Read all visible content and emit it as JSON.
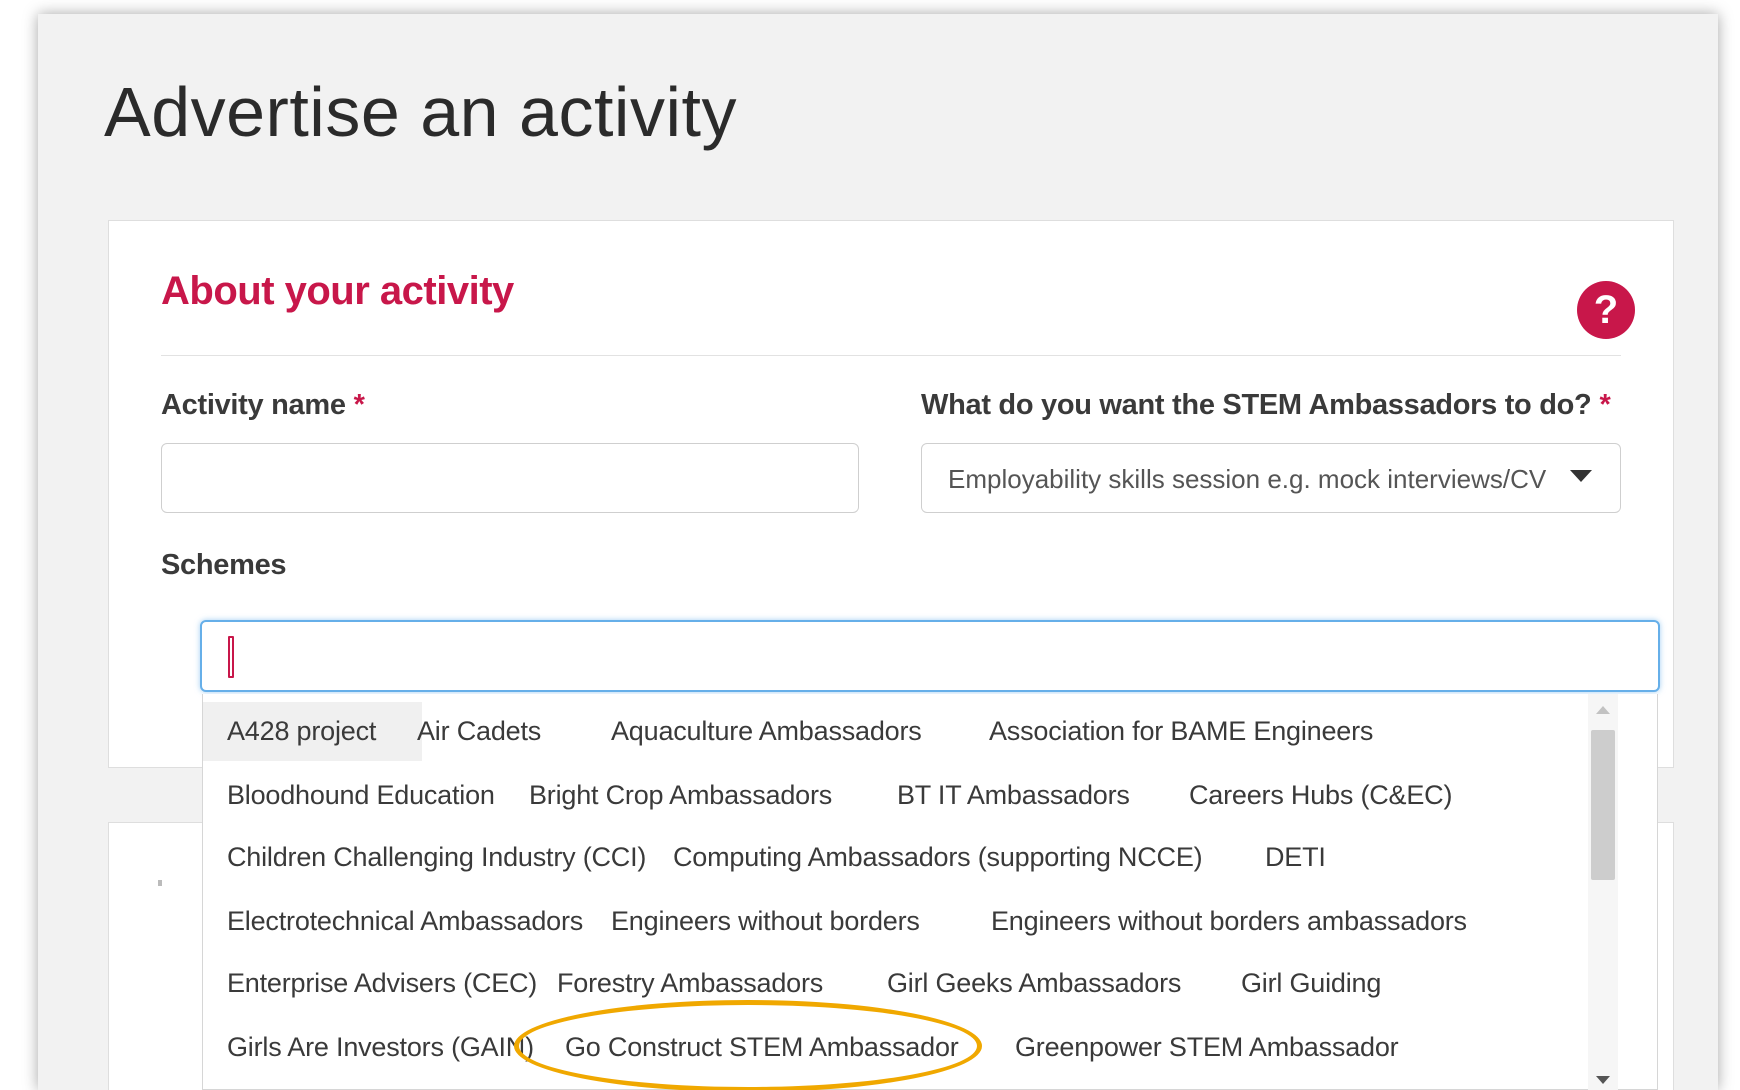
{
  "page": {
    "title": "Advertise an activity"
  },
  "section": {
    "title": "About your activity",
    "help_icon": "?"
  },
  "form": {
    "activity_name": {
      "label": "Activity name",
      "required": "*",
      "value": ""
    },
    "ambassador_task": {
      "label": "What do you want the STEM Ambassadors to do?",
      "required": "*",
      "selected": "Employability skills session e.g. mock interviews/CV writing"
    },
    "schemes": {
      "label": "Schemes",
      "value": "",
      "options": [
        "A428 project",
        "Air Cadets",
        "Aquaculture Ambassadors",
        "Association for BAME Engineers",
        "Bloodhound Education",
        "Bright Crop Ambassadors",
        "BT IT Ambassadors",
        "Careers Hubs (C&EC)",
        "Children Challenging Industry (CCI)",
        "Computing Ambassadors (supporting NCCE)",
        "DETI",
        "Electrotechnical Ambassadors",
        "Engineers without borders",
        "Engineers without borders ambassadors",
        "Enterprise Advisers (CEC)",
        "Forestry Ambassadors",
        "Girl Geeks Ambassadors",
        "Girl Guiding",
        "Girls Are Investors (GAIN)",
        "Go Construct STEM Ambassador",
        "Greenpower STEM Ambassador"
      ],
      "highlighted_option": "A428 project",
      "circled_option": "Go Construct STEM Ambassador"
    }
  },
  "colors": {
    "accent": "#c8174a",
    "focus": "#66afe9",
    "annotation": "#f0a800"
  }
}
